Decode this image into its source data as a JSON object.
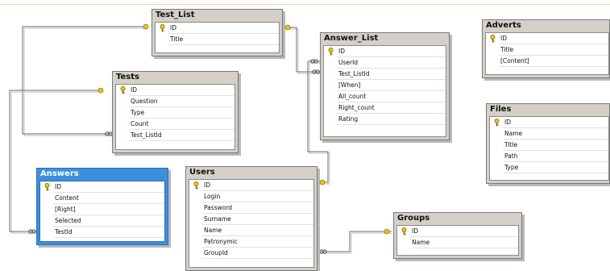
{
  "tables": {
    "test_list": {
      "title": "Test_List",
      "columns": [
        "ID",
        "Title"
      ],
      "key_column": "ID"
    },
    "answer_list": {
      "title": "Answer_List",
      "columns": [
        "ID",
        "UserId",
        "Test_ListId",
        "[When]",
        "All_count",
        "Right_count",
        "Rating"
      ],
      "key_column": "ID"
    },
    "tests": {
      "title": "Tests",
      "columns": [
        "ID",
        "Question",
        "Type",
        "Count",
        "Test_ListId"
      ],
      "key_column": "ID"
    },
    "answers": {
      "title": "Answers",
      "columns": [
        "ID",
        "Content",
        "[Right]",
        "Selected",
        "TestId"
      ],
      "key_column": "ID",
      "selected": true
    },
    "users": {
      "title": "Users",
      "columns": [
        "ID",
        "Login",
        "Password",
        "Surname",
        "Name",
        "Patronymic",
        "GroupId"
      ],
      "key_column": "ID"
    },
    "groups": {
      "title": "Groups",
      "columns": [
        "ID",
        "Name"
      ],
      "key_column": "ID"
    },
    "adverts": {
      "title": "Adverts",
      "columns": [
        "ID",
        "Title",
        "[Content]"
      ],
      "key_column": "ID"
    },
    "files": {
      "title": "Files",
      "columns": [
        "ID",
        "Name",
        "Title",
        "Path",
        "Type"
      ],
      "key_column": "ID"
    }
  },
  "relationships": [
    {
      "from": "tests.Test_ListId",
      "to": "test_list.ID"
    },
    {
      "from": "answer_list.Test_ListId",
      "to": "test_list.ID"
    },
    {
      "from": "answers.TestId",
      "to": "tests.ID"
    },
    {
      "from": "answer_list.UserId",
      "to": "users.ID"
    },
    {
      "from": "users.GroupId",
      "to": "groups.ID"
    }
  ],
  "colors": {
    "table_header": "#d4d0c8",
    "selected_header": "#3e8fdb",
    "key_icon": "#f2c200",
    "line": "#6b6b6b"
  },
  "icons": {
    "primary_key": "key-icon",
    "one_end": "key-icon",
    "many_end": "infinity-icon"
  }
}
